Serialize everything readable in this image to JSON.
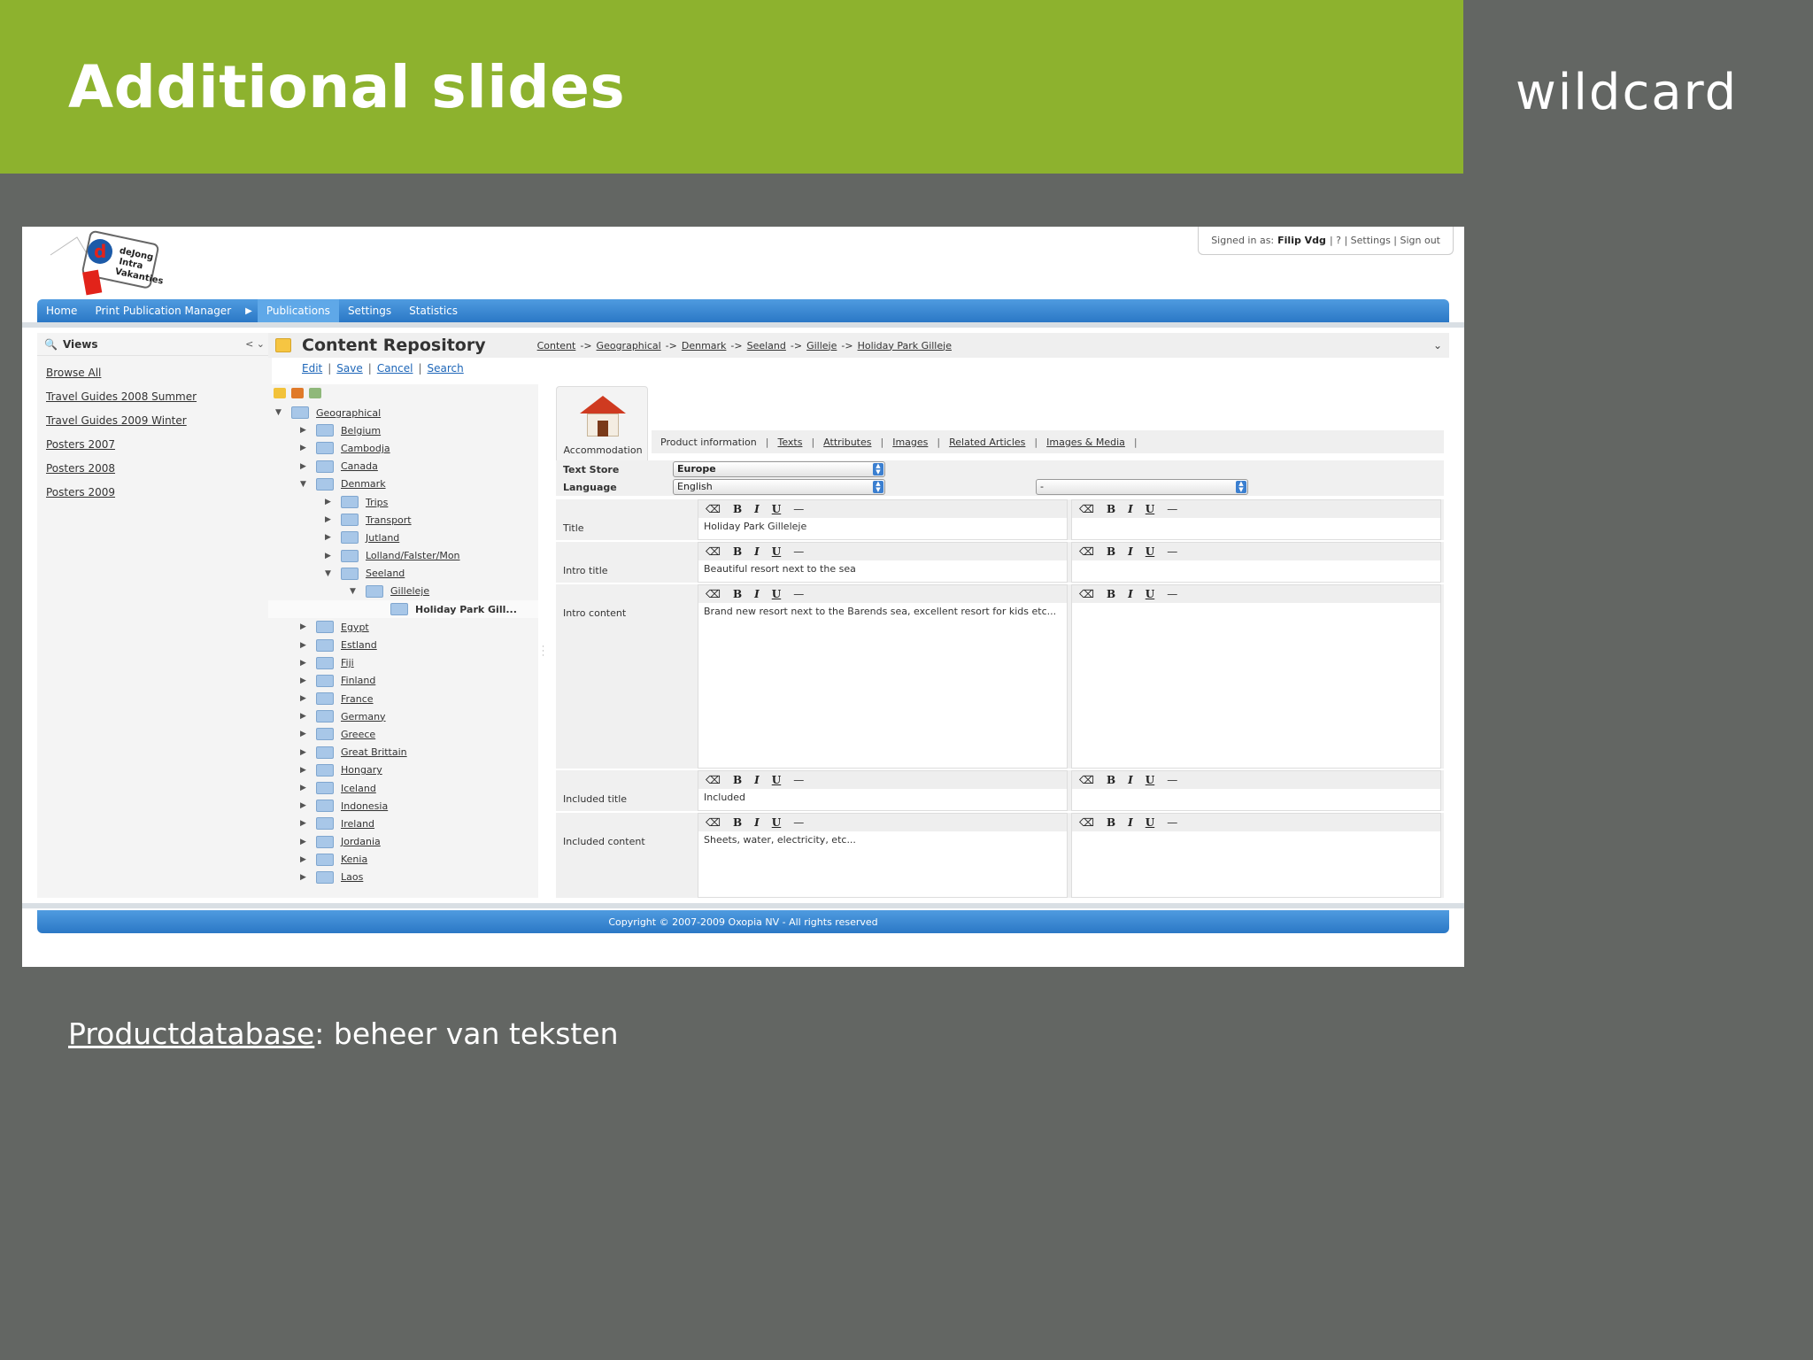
{
  "slide": {
    "title": "Additional slides",
    "logo": "wildcard",
    "caption_link": "Productdatabase",
    "caption_rest": ": beheer van teksten"
  },
  "colors": {
    "accent_green": "#8db22e",
    "background": "#636663",
    "nav_blue": "#2b78c6"
  },
  "app": {
    "signin": {
      "prefix": "Signed in as:",
      "user": "Filip Vdg",
      "links": "| ? | Settings | Sign out"
    },
    "nav": [
      "Home",
      "Print Publication Manager",
      "Publications",
      "Settings",
      "Statistics"
    ],
    "views": {
      "title": "Views",
      "items": [
        "Browse All",
        "Travel Guides 2008 Summer",
        "Travel Guides 2009 Winter",
        "Posters 2007",
        "Posters 2008",
        "Posters 2009"
      ]
    },
    "repo": {
      "title": "Content Repository",
      "breadcrumb": [
        "Content",
        "Geographical",
        "Denmark",
        "Seeland",
        "Gilleje",
        "Holiday Park Gilleje"
      ],
      "actions": [
        "Edit",
        "Save",
        "Cancel",
        "Search"
      ]
    },
    "tree": [
      {
        "label": "Geographical",
        "level": 0,
        "twisty": "▼"
      },
      {
        "label": "Belgium",
        "level": 1,
        "twisty": "▶"
      },
      {
        "label": "Cambodja",
        "level": 1,
        "twisty": "▶"
      },
      {
        "label": "Canada",
        "level": 1,
        "twisty": "▶"
      },
      {
        "label": "Denmark",
        "level": 1,
        "twisty": "▼"
      },
      {
        "label": "Trips",
        "level": 2,
        "twisty": "▶"
      },
      {
        "label": "Transport",
        "level": 2,
        "twisty": "▶"
      },
      {
        "label": "Jutland",
        "level": 2,
        "twisty": "▶"
      },
      {
        "label": "Lolland/Falster/Mon",
        "level": 2,
        "twisty": "▶"
      },
      {
        "label": "Seeland",
        "level": 2,
        "twisty": "▼"
      },
      {
        "label": "Gilleleje",
        "level": 3,
        "twisty": "▼"
      },
      {
        "label": "Holiday Park Gill...",
        "level": 4,
        "twisty": "",
        "bold": true
      },
      {
        "label": "Egypt",
        "level": 1,
        "twisty": "▶"
      },
      {
        "label": "Estland",
        "level": 1,
        "twisty": "▶"
      },
      {
        "label": "Fiji",
        "level": 1,
        "twisty": "▶"
      },
      {
        "label": "Finland",
        "level": 1,
        "twisty": "▶"
      },
      {
        "label": "France",
        "level": 1,
        "twisty": "▶"
      },
      {
        "label": "Germany",
        "level": 1,
        "twisty": "▶"
      },
      {
        "label": "Greece",
        "level": 1,
        "twisty": "▶"
      },
      {
        "label": "Great Brittain",
        "level": 1,
        "twisty": "▶"
      },
      {
        "label": "Hongary",
        "level": 1,
        "twisty": "▶"
      },
      {
        "label": "Iceland",
        "level": 1,
        "twisty": "▶"
      },
      {
        "label": "Indonesia",
        "level": 1,
        "twisty": "▶"
      },
      {
        "label": "Ireland",
        "level": 1,
        "twisty": "▶"
      },
      {
        "label": "Jordania",
        "level": 1,
        "twisty": "▶"
      },
      {
        "label": "Kenia",
        "level": 1,
        "twisty": "▶"
      },
      {
        "label": "Laos",
        "level": 1,
        "twisty": "▶"
      }
    ],
    "editor": {
      "accommodation_label": "Accommodation",
      "tabs": [
        "Product information",
        "Texts",
        "Attributes",
        "Images",
        "Related Articles",
        "Images & Media"
      ],
      "text_store_label": "Text Store",
      "text_store_value": "Europe",
      "language_label": "Language",
      "language_value": "English",
      "language2_value": "-",
      "toolbar": {
        "b": "B",
        "i": "I",
        "u": "U",
        "hr": "—"
      },
      "fields": {
        "title_label": "Title",
        "title_value": "Holiday Park Gilleleje",
        "intro_title_label": "Intro title",
        "intro_title_value": "Beautiful resort next to the sea",
        "intro_content_label": "Intro content",
        "intro_content_value": "Brand new resort next to the Barends sea, excellent resort for kids etc...",
        "included_title_label": "Included title",
        "included_title_value": "Included",
        "included_content_label": "Included content",
        "included_content_value": "Sheets, water, electricity, etc..."
      }
    },
    "footer": "Copyright © 2007-2009 Oxopia NV - All rights reserved"
  }
}
